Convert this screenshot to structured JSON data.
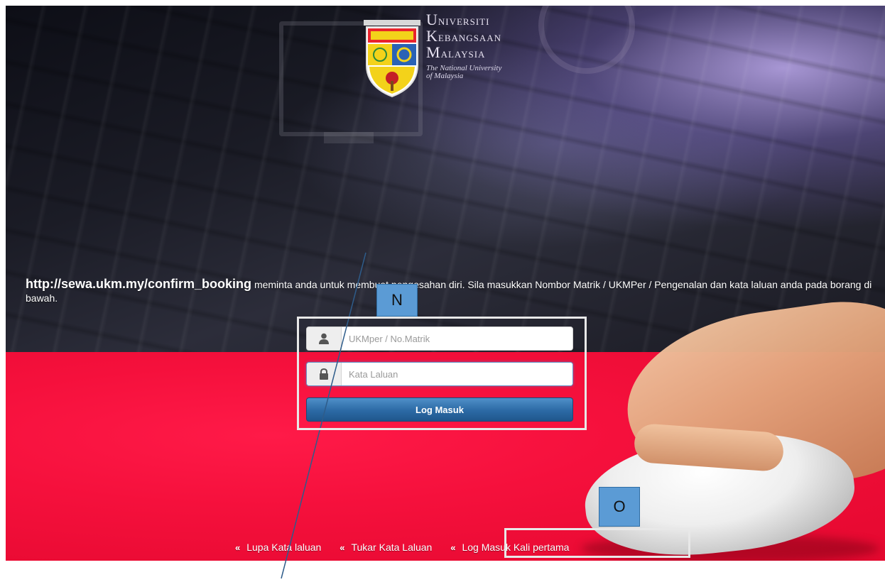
{
  "logo": {
    "university_line1_cap": "U",
    "university_line1_rest": "NIVERSITI",
    "university_line2_cap": "K",
    "university_line2_rest": "EBANGSAAN",
    "university_line3_cap": "M",
    "university_line3_rest": "ALAYSIA",
    "tagline_1": "The National University",
    "tagline_2": "of Malaysia"
  },
  "message": {
    "url": "http://sewa.ukm.my/confirm_booking",
    "text": "meminta anda untuk membuat pengesahan diri. Sila masukkan Nombor Matrik / UKMPer / Pengenalan dan kata laluan anda pada borang di bawah."
  },
  "login": {
    "username_placeholder": "UKMper / No.Matrik",
    "password_placeholder": "Kata Laluan",
    "submit_label": "Log Masuk"
  },
  "links": {
    "arrow": "«",
    "forgot_password": "Lupa Kata laluan",
    "change_password": "Tukar Kata Laluan",
    "first_login": "Log Masuk Kali pertama"
  },
  "annotations": {
    "label_n": "N",
    "label_o": "O"
  },
  "colors": {
    "red_background": "#f5103c",
    "button_blue": "#2c6aa5",
    "annotation_label": "#5b9bd5"
  }
}
